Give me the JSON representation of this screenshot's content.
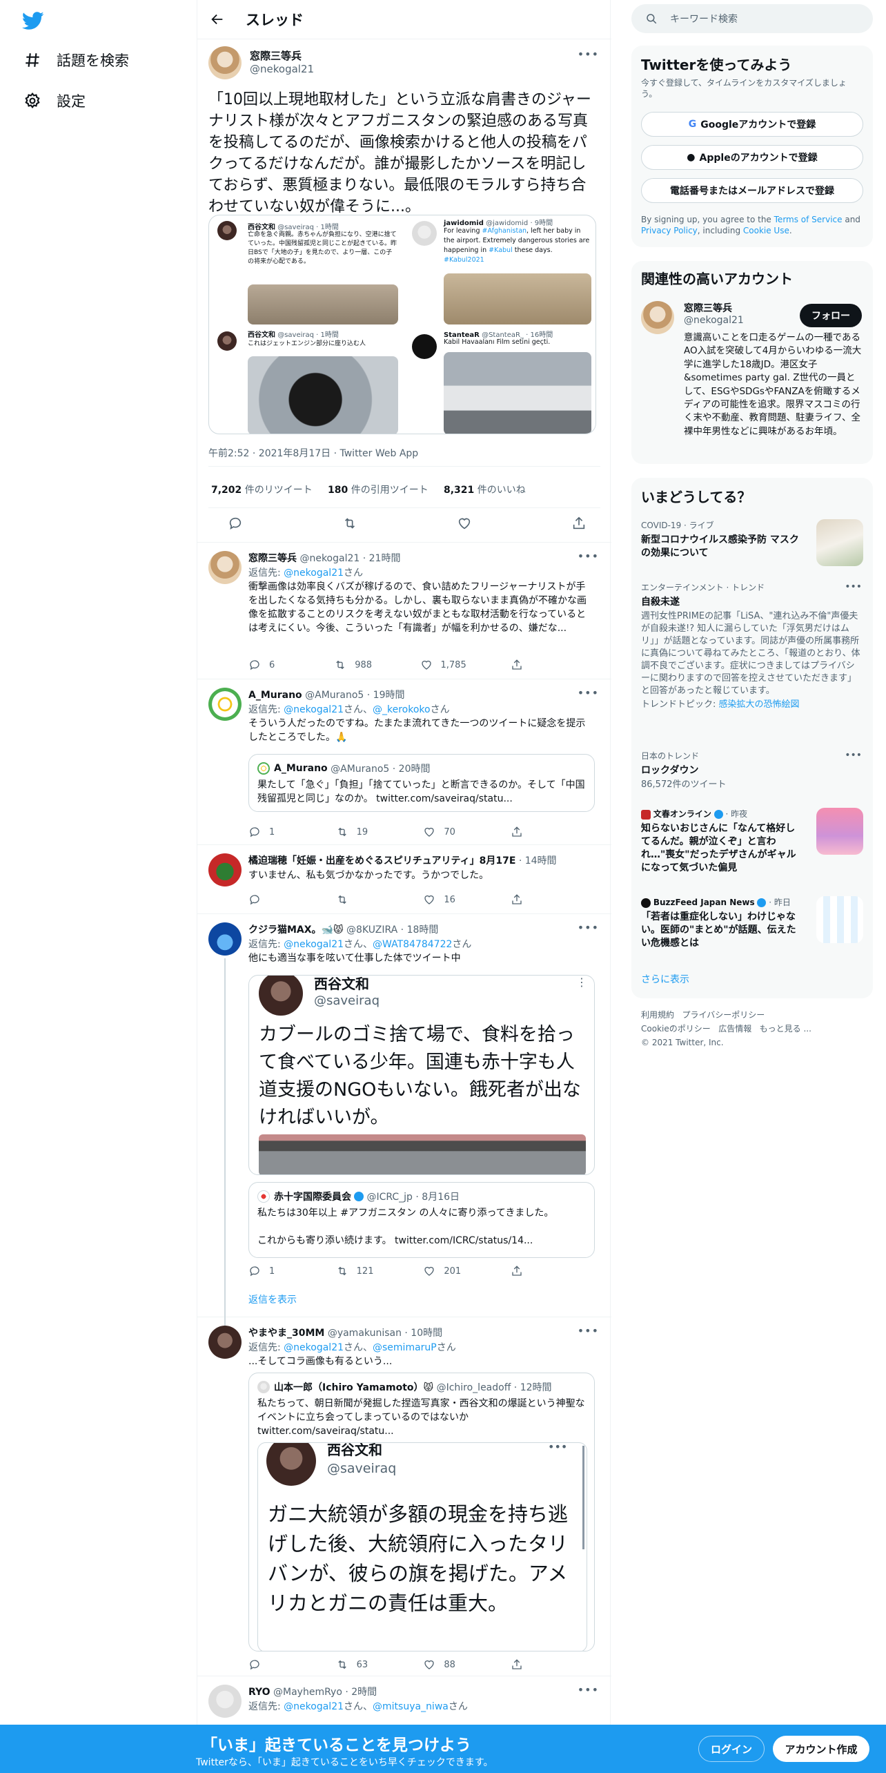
{
  "nav": {
    "explore_label": "話題を検索",
    "settings_label": "設定"
  },
  "header": {
    "title": "スレッド"
  },
  "main_tweet": {
    "name": "窓際三等兵",
    "handle": "@nekogal21",
    "text": "「10回以上現地取材した」という立派な肩書きのジャーナリスト様が次々とアフガニスタンの緊迫感のある写真を投稿してるのだが、画像検索かけると他人の投稿をパクってるだけなんだが。誰が撮影したかソースを明記しておらず、悪質極まりない。最低限のモラルすら持ち合わせていない奴が偉そうに...。",
    "embedded": {
      "a_name": "西谷文和",
      "a_meta": "@saveiraq · 1時間",
      "a_text": "亡命を急ぐ両親。赤ちゃんが負担になり、空港に捨てていった。中国残留孤児と同じことが起きている。昨日BSで「大地の子」を見たので、より一層、この子の将来が心配である。",
      "b_name": "jawidomid",
      "b_meta": "@jawidomid · 9時間",
      "b_text1": "For leaving ",
      "b_link1": "#Afghanistan",
      "b_text2": ", left her baby in the airport. Extremely dangerous stories are happening in ",
      "b_link2": "#Kabul",
      "b_text3": " these days.",
      "b_link3": "#Kabul2021",
      "c_name": "西谷文和",
      "c_meta": "@saveiraq · 1時間",
      "c_text": "これはジェットエンジン部分に座り込む人",
      "d_name": "StanteaR",
      "d_meta": "@StanteaR_ · 16時間",
      "d_text": "Kabil Havaalanı Film setini geçti."
    },
    "timestamp": "午前2:52 · 2021年8月17日 · Twitter Web App",
    "retweets_count": "7,202",
    "retweets_label": " 件のリツイート",
    "quotes_count": "180",
    "quotes_label": " 件の引用ツイート",
    "likes_count": "8,321",
    "likes_label": " 件のいいね"
  },
  "replies": [
    {
      "name": "窓際三等兵",
      "meta": "@nekogal21 · 21時間",
      "reply_to_prefix": "返信先: ",
      "reply_to": "@nekogal21",
      "reply_to_suffix": "さん",
      "text": "衝撃画像は効率良くバズが稼げるので、食い詰めたフリージャーナリストが手を出したくなる気持ちも分かる。しかし、裏も取らないまま真偽が不確かな画像を拡散することのリスクを考えない奴がまともな取材活動を行なっているとは考えにくい。今後、こういった「有識者」が幅を利かせるの、嫌だな...",
      "replies": "6",
      "retweets": "988",
      "likes": "1,785"
    },
    {
      "name": "A_Murano",
      "meta": "@AMurano5 · 19時間",
      "reply_to_prefix": "返信先: ",
      "reply_to": "@nekogal21",
      "reply_to_mid": "さん、",
      "reply_to2": "@_kerokoko",
      "reply_to_suffix": "さん",
      "text": "そういう人だったのですね。たまたま流れてきた一つのツイートに疑念を提示したところでした。🙏",
      "quote_name": "A_Murano",
      "quote_meta": "@AMurano5 · 20時間",
      "quote_text": "果たして「急ぐ」「負担」「捨てていった」と断言できるのか。そして「中国残留孤児と同じ」なのか。 twitter.com/saveiraq/statu...",
      "replies": "1",
      "retweets": "19",
      "likes": "70"
    },
    {
      "name": "橘迫瑞穂「妊娠・出産をめぐるスピリチュアリティ」8月17E",
      "meta": "· 14時間",
      "text": "すいません、私も気づかなかったです。うかつでした。",
      "replies": "",
      "retweets": "",
      "likes": "16"
    },
    {
      "name": "クジラ猫MAX。🐋😾",
      "meta": "@8KUZIRA · 18時間",
      "reply_to_prefix": "返信先: ",
      "reply_to": "@nekogal21",
      "reply_to_mid": "さん、",
      "reply_to2": "@WAT84784722",
      "reply_to_suffix": "さん",
      "text": "他にも適当な事を呟いて仕事した体でツイート中",
      "img_name": "西谷文和",
      "img_handle": "@saveiraq",
      "img_text": "カブールのゴミ捨て場で、食料を拾って食べている少年。国連も赤十字も人道支援のNGOもいない。餓死者が出なければいいが。",
      "quote_name": "赤十字国際委員会",
      "quote_meta": "@ICRC_jp · 8月16日",
      "quote_text1": "私たちは30年以上 #アフガニスタン の人々に寄り添ってきました。",
      "quote_text2": "これからも寄り添い続けます。 twitter.com/ICRC/status/14...",
      "replies": "1",
      "retweets": "121",
      "likes": "201",
      "show_replies": "返信を表示"
    },
    {
      "name": "やまやま_30MM",
      "meta": "@yamakunisan · 10時間",
      "reply_to_prefix": "返信先: ",
      "reply_to": "@nekogal21",
      "reply_to_mid": "さん、",
      "reply_to2": "@semimaruP",
      "reply_to_suffix": "さん",
      "text": "...そしてコラ画像も有るという...",
      "quote_name": "山本一郎（Ichiro Yamamoto）😾",
      "quote_meta": "@Ichiro_leadoff · 12時間",
      "quote_text": "私たちって、朝日新聞が発掘した捏造写真家・西谷文和の爆誕という神聖なイベントに立ち会ってしまっているのではないか twitter.com/saveiraq/statu...",
      "img_name": "西谷文和",
      "img_handle": "@saveiraq",
      "img_text": "ガニ大統領が多額の現金を持ち逃げした後、大統領府に入ったタリバンが、彼らの旗を掲げた。アメリカとガニの責任は重大。",
      "replies": "",
      "retweets": "63",
      "likes": "88"
    },
    {
      "name": "RYO",
      "meta": "@MayhemRyo · 2時間",
      "reply_to_prefix": "返信先: ",
      "reply_to": "@nekogal21",
      "reply_to_mid": "さん、",
      "reply_to2": "@mitsuya_niwa",
      "reply_to_suffix": "さん"
    }
  ],
  "search": {
    "placeholder": "キーワード検索"
  },
  "signup": {
    "title": "Twitterを使ってみよう",
    "subtitle": "今すぐ登録して、タイムラインをカスタマイズしましょう。",
    "google": "Googleアカウントで登録",
    "apple": "Appleのアカウントで登録",
    "phone": "電話番号またはメールアドレスで登録",
    "legal1": "By signing up, you agree to the ",
    "tos": "Terms of Service",
    "legal2": " and ",
    "privacy": "Privacy Policy",
    "legal3": ", including ",
    "cookie": "Cookie Use",
    "legal4": "."
  },
  "related": {
    "title": "関連性の高いアカウント",
    "name": "窓際三等兵",
    "handle": "@nekogal21",
    "follow": "フォロー",
    "bio": "意識高いことを口走るゲームの一種であるAO入試を突破して4月からいわゆる一流大学に進学した18歳JD。港区女子&sometimes party gal. Z世代の一員として、ESGやSDGsやFANZAを俯瞰するメディアの可能性を追求。限界マスコミの行く末や不動産、教育問題、駐妻ライフ、全裸中年男性などに興味があるお年頃。"
  },
  "trends": {
    "title": "いまどうしてる？",
    "items": [
      {
        "cat": "COVID-19 · ライブ",
        "name": "新型コロナウイルス感染予防 マスクの効果について"
      },
      {
        "cat": "エンターテインメント · トレンド",
        "name": "自殺未遂",
        "sub": "週刊女性PRIMEの記事「LiSA、\"連れ込み不倫\"声優夫が自殺未遂!? 知人に漏らしていた「浮気男だけはムリ」」が話題となっています。同誌が声優の所属事務所に真偽について尋ねてみたところ、「報道のとおり、体調不良でございます。症状につきましてはプライバシーに関わりますので回答を控えさせていただきます」と回答があったと報じています。",
        "topic_prefix": "トレンドトピック: ",
        "topic": "感染拡大の恐怖絵図"
      },
      {
        "cat": "日本のトレンド",
        "name": "ロックダウン",
        "sub": "86,572件のツイート"
      },
      {
        "cat": "文春オンライン",
        "meta": "· 昨夜",
        "name": "知らないおじさんに「なんて格好してるんだ。親が泣くぞ」と言われ…\"喪女\"だったデザさんがギャルになって気づいた偏見"
      },
      {
        "cat": "BuzzFeed Japan News",
        "meta": "· 昨日",
        "name": "「若者は重症化しない」わけじゃない。医師の\"まとめ\"が話題、伝えたい危機感とは"
      }
    ],
    "show_more": "さらに表示"
  },
  "footer": {
    "l1": "利用規約",
    "l2": "プライバシーポリシー",
    "l3": "Cookieのポリシー",
    "l4": "広告情報",
    "l5": "もっと見る ...",
    "copy": "© 2021 Twitter, Inc."
  },
  "bottom_bar": {
    "title": "「いま」起きていることを見つけよう",
    "subtitle": "Twitterなら、「いま」起きていることをいち早くチェックできます。",
    "login": "ログイン",
    "signup": "アカウント作成"
  },
  "colors": {
    "accent": "#1d9bf0",
    "text": "#0f1419",
    "muted": "#536471",
    "border": "#eff3f4"
  }
}
